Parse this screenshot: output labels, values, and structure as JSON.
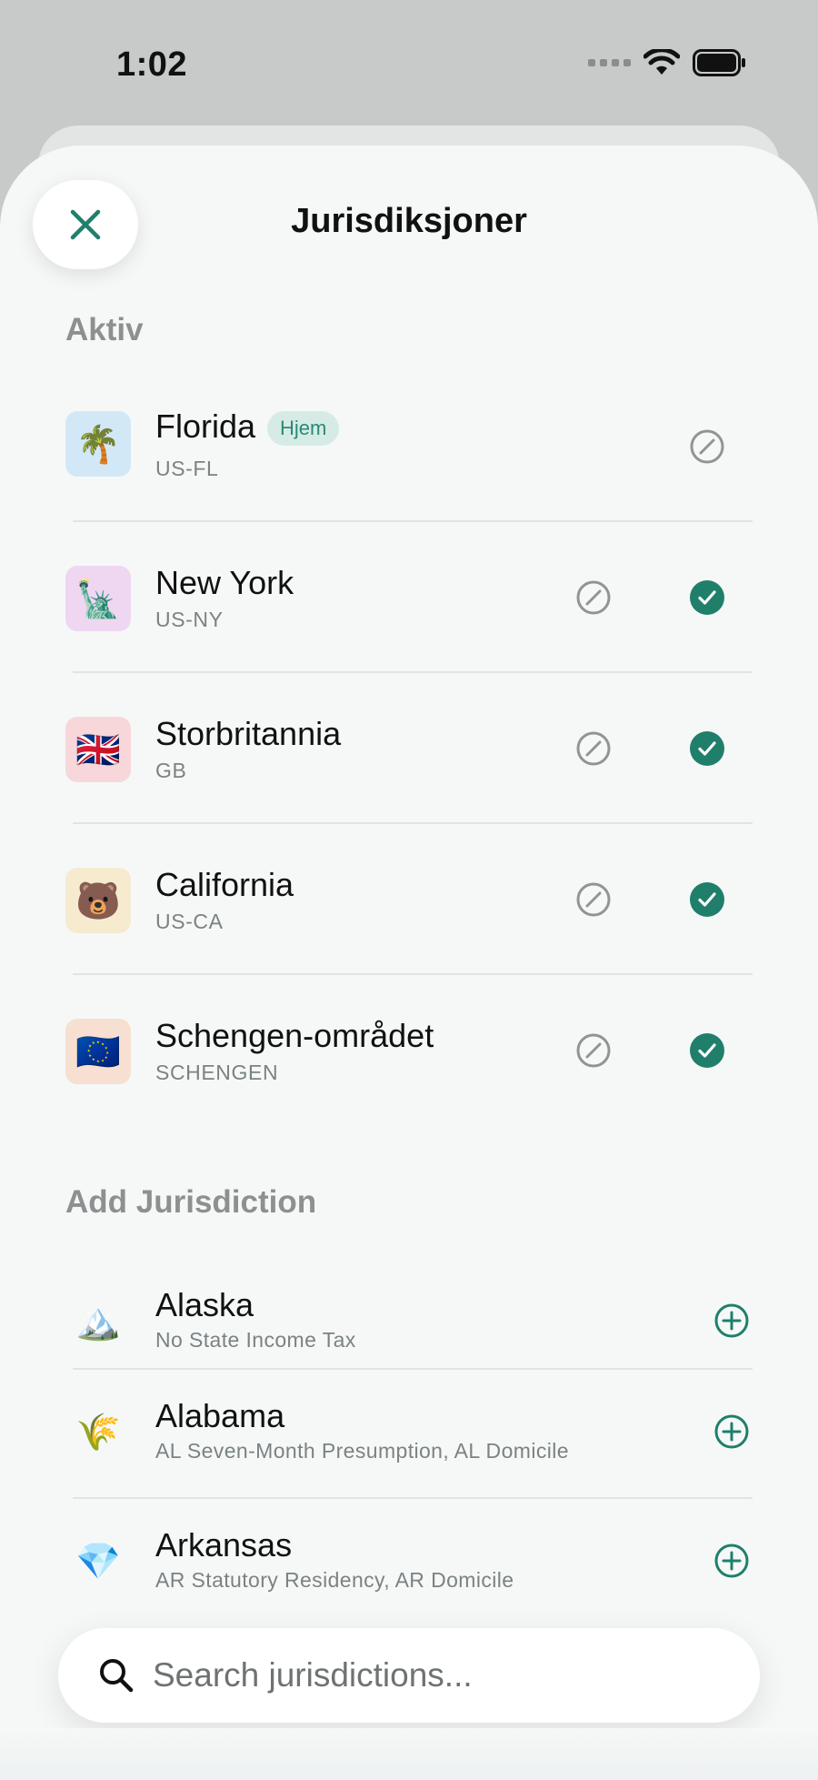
{
  "status_bar": {
    "time": "1:02"
  },
  "sheet": {
    "title": "Jurisdiksjoner"
  },
  "active_section": {
    "title": "Aktiv",
    "items": [
      {
        "name": "Florida",
        "code": "US-FL",
        "emoji": "🌴",
        "badge": "Hjem",
        "selected": false,
        "icon_bg": "#d3e8f6"
      },
      {
        "name": "New York",
        "code": "US-NY",
        "emoji": "🗽",
        "selected": true,
        "icon_bg": "#efd6f1"
      },
      {
        "name": "Storbritannia",
        "code": "GB",
        "emoji": "🇬🇧",
        "selected": true,
        "icon_bg": "#f7d7da"
      },
      {
        "name": "California",
        "code": "US-CA",
        "emoji": "🐻",
        "selected": true,
        "icon_bg": "#f6ebcf"
      },
      {
        "name": "Schengen-området",
        "code": "SCHENGEN",
        "emoji": "🇪🇺",
        "selected": true,
        "icon_bg": "#f7e0d1"
      }
    ]
  },
  "add_section": {
    "title": "Add Jurisdiction",
    "items": [
      {
        "name": "Alaska",
        "subtitle": "No State Income Tax",
        "emoji": "🏔️"
      },
      {
        "name": "Alabama",
        "subtitle": "AL Seven-Month Presumption, AL Domicile",
        "emoji": "🌾"
      },
      {
        "name": "Arkansas",
        "subtitle": "AR Statutory Residency, AR Domicile",
        "emoji": "💎"
      }
    ]
  },
  "search": {
    "placeholder": "Search jurisdictions..."
  },
  "colors": {
    "accent": "#1f7f6b",
    "muted_icon": "#8f9596",
    "badge_bg": "#d6ebe6"
  },
  "icons": {
    "close": "close-icon",
    "edit": "edit-icon",
    "check": "check-circle-icon",
    "add": "plus-circle-icon",
    "search": "search-icon"
  }
}
